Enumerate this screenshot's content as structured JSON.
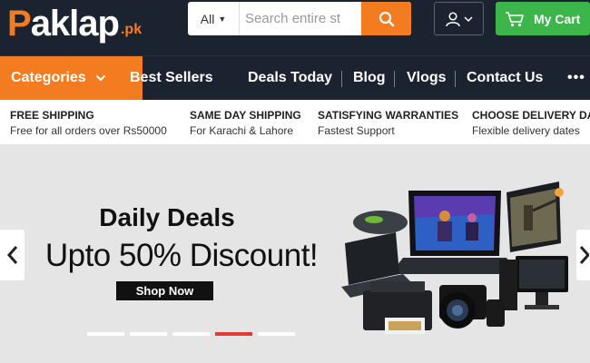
{
  "brand": {
    "logo_first": "P",
    "logo_rest": "aklap",
    "logo_tld": ".pk",
    "accent": "#f47c20",
    "header_bg": "#1b2230",
    "cart_green": "#3cb54a"
  },
  "search": {
    "category": "All",
    "placeholder": "Search entire st",
    "button_icon": "search-icon"
  },
  "account": {
    "icon": "user-icon"
  },
  "cart": {
    "label": "My Cart",
    "icon": "cart-icon"
  },
  "nav": {
    "categories_label": "Categories",
    "items": [
      "Best Sellers",
      "Deals Today",
      "Blog",
      "Vlogs",
      "Contact Us"
    ],
    "more": "•••"
  },
  "info": [
    {
      "title": "FREE SHIPPING",
      "sub": "Free for all orders over Rs50000"
    },
    {
      "title": "SAME DAY SHIPPING",
      "sub": "For Karachi & Lahore"
    },
    {
      "title": "SATISFYING WARRANTIES",
      "sub": "Fastest Support"
    },
    {
      "title": "CHOOSE DELIVERY DAY",
      "sub": "Flexible delivery dates"
    }
  ],
  "banner": {
    "title": "Daily Deals",
    "subtitle": "Upto 50% Discount!",
    "button": "Shop Now",
    "slides": 5,
    "active_slide": 4
  }
}
